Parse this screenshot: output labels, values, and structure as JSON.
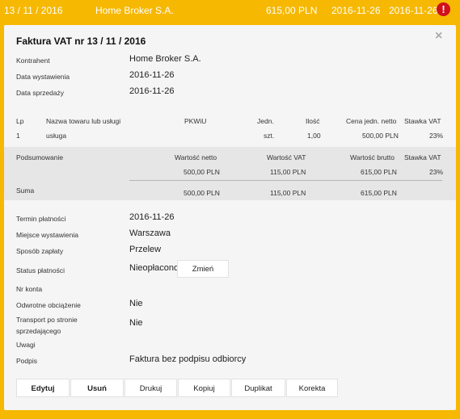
{
  "list_row": {
    "number": "13 / 11 / 2016",
    "contractor": "Home Broker S.A.",
    "amount": "615,00 PLN",
    "date1": "2016-11-26",
    "date2": "2016-11-26",
    "alert_symbol": "!"
  },
  "modal": {
    "title": "Faktura VAT nr 13 / 11 / 2016",
    "close_symbol": "×",
    "info": {
      "contractor_label": "Kontrahent",
      "contractor_value": "Home Broker S.A.",
      "issue_date_label": "Data wystawienia",
      "issue_date_value": "2016-11-26",
      "sale_date_label": "Data sprzedaży",
      "sale_date_value": "2016-11-26"
    },
    "items_table": {
      "headers": [
        "Lp",
        "Nazwa towaru lub usługi",
        "PKWiU",
        "Jedn.",
        "Ilość",
        "Cena jedn. netto",
        "Stawka VAT"
      ],
      "rows": [
        [
          "1",
          "usługa",
          "",
          "szt.",
          "1,00",
          "500,00 PLN",
          "23%"
        ]
      ]
    },
    "summary": {
      "label": "Podsumowanie",
      "headers": [
        "Wartość netto",
        "Wartość VAT",
        "Wartość brutto",
        "Stawka VAT"
      ],
      "row": [
        "500,00 PLN",
        "115,00 PLN",
        "615,00 PLN",
        "23%"
      ],
      "sum_label": "Suma",
      "sum_row": [
        "500,00 PLN",
        "115,00 PLN",
        "615,00 PLN"
      ]
    },
    "details": {
      "due_label": "Termin płatności",
      "due_value": "2016-11-26",
      "place_label": "Miejsce wystawienia",
      "place_value": "Warszawa",
      "method_label": "Sposób zapłaty",
      "method_value": "Przelew",
      "status_label": "Status płatności",
      "status_value": "Nieopłacono",
      "change_label": "Zmień",
      "account_label": "Nr konta",
      "reverse_label": "Odwrotne obciążenie",
      "reverse_value": "Nie",
      "transport_label_1": "Transport po stronie",
      "transport_label_2": "sprzedającego",
      "transport_value": "Nie",
      "notes_label": "Uwagi",
      "sign_label": "Podpis",
      "sign_value": "Faktura bez podpisu odbiorcy"
    },
    "buttons": {
      "edit": "Edytuj",
      "delete": "Usuń",
      "print": "Drukuj",
      "copy": "Kopiuj",
      "duplicate": "Duplikat",
      "correction": "Korekta"
    }
  }
}
